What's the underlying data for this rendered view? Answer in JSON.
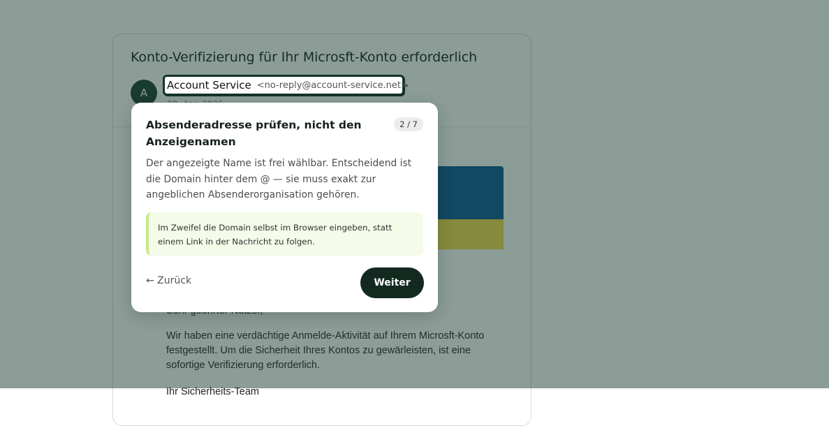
{
  "email": {
    "subject": "Konto-Verifizierung für Ihr Microsft-Konto erforderlich",
    "avatar_initial": "A",
    "sender_name": "Account Service",
    "sender_address": "<no-reply@account-service.net>",
    "date": "28. Apr. 2026",
    "greeting": "Sehr geehrter Nutzer,",
    "paragraph": "Wir haben eine verdächtige Anmelde-Aktivität auf Ihrem Microsft-Konto festgestellt. Um die Sicherheit Ihres Kontos zu gewärleisten, ist eine sofortige Verifizierung erforderlich.",
    "signature": "Ihr Sicherheits-Team"
  },
  "tour": {
    "title": "Absenderadresse prüfen, nicht den Anzeigenamen",
    "step": "2 / 7",
    "description": "Der angezeigte Name ist frei wählbar. Entscheidend ist die Domain hinter dem @ — sie muss exakt zur angeblichen Absenderorganisation gehören.",
    "tip": "Im Zweifel die Domain selbst im Browser eingeben, statt einem Link in der Nachricht zu folgen.",
    "back_label": "← Zurück",
    "next_label": "Weiter"
  },
  "colors": {
    "overlay": "#5f7a6f",
    "accent_dark": "#12291f",
    "tip_border": "#c8ea86",
    "banner_blue": "#0a5596",
    "banner_yellow": "#f5d94a"
  }
}
